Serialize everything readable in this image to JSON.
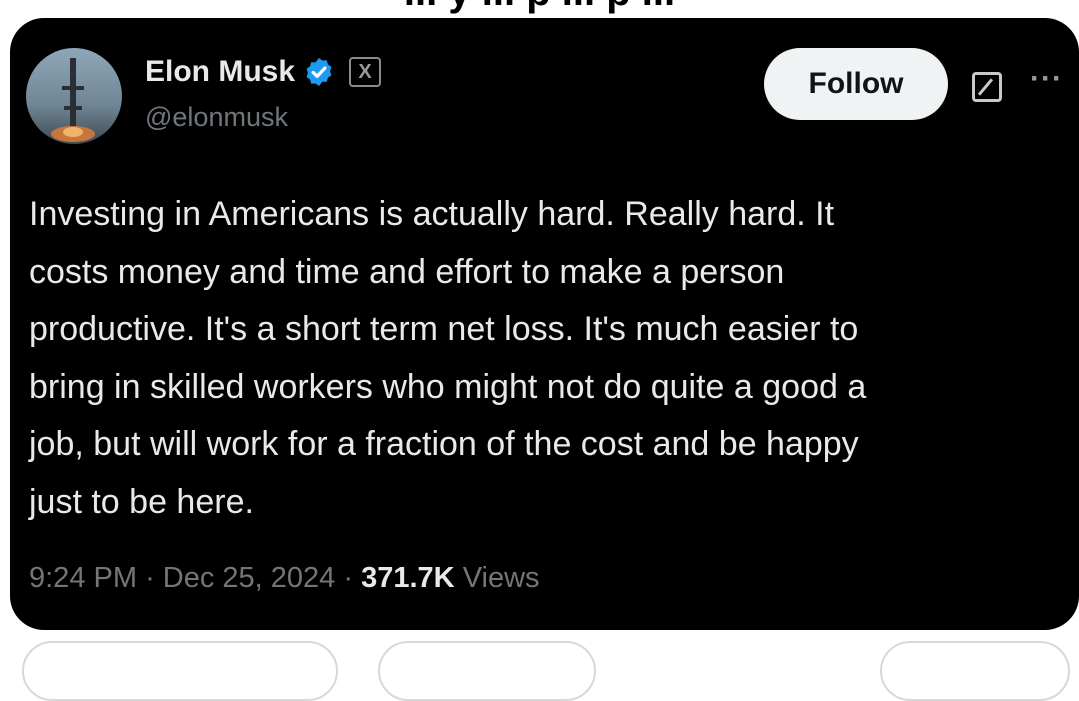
{
  "page": {
    "header_text": "... y ... p ... p ..."
  },
  "tweet": {
    "author_name": "Elon Musk",
    "verified_icon": "verified-badge-icon",
    "affiliation_badge": "X",
    "handle": "@elonmusk",
    "follow_label": "Follow",
    "text_lines": [
      "Investing in Americans is actually hard. Really hard. It",
      "costs money and time and effort to make a person",
      "productive. It's a short term net loss. It's much easier to",
      "bring in skilled workers who might not do quite a good a",
      "job, but will work for a fraction of the cost and be happy",
      "just to be here."
    ],
    "time": "9:24 PM",
    "separator": "·",
    "date": "Dec 25, 2024",
    "views_count": "371.7K",
    "views_label": "Views",
    "more_icon": "more-icon",
    "grok_icon": "grok-icon"
  },
  "colors": {
    "card_background": "#000000",
    "text_primary": "#e7e9ea",
    "text_secondary": "#71767b",
    "verified_blue": "#1d9bf0",
    "follow_background": "#eff3f4"
  }
}
